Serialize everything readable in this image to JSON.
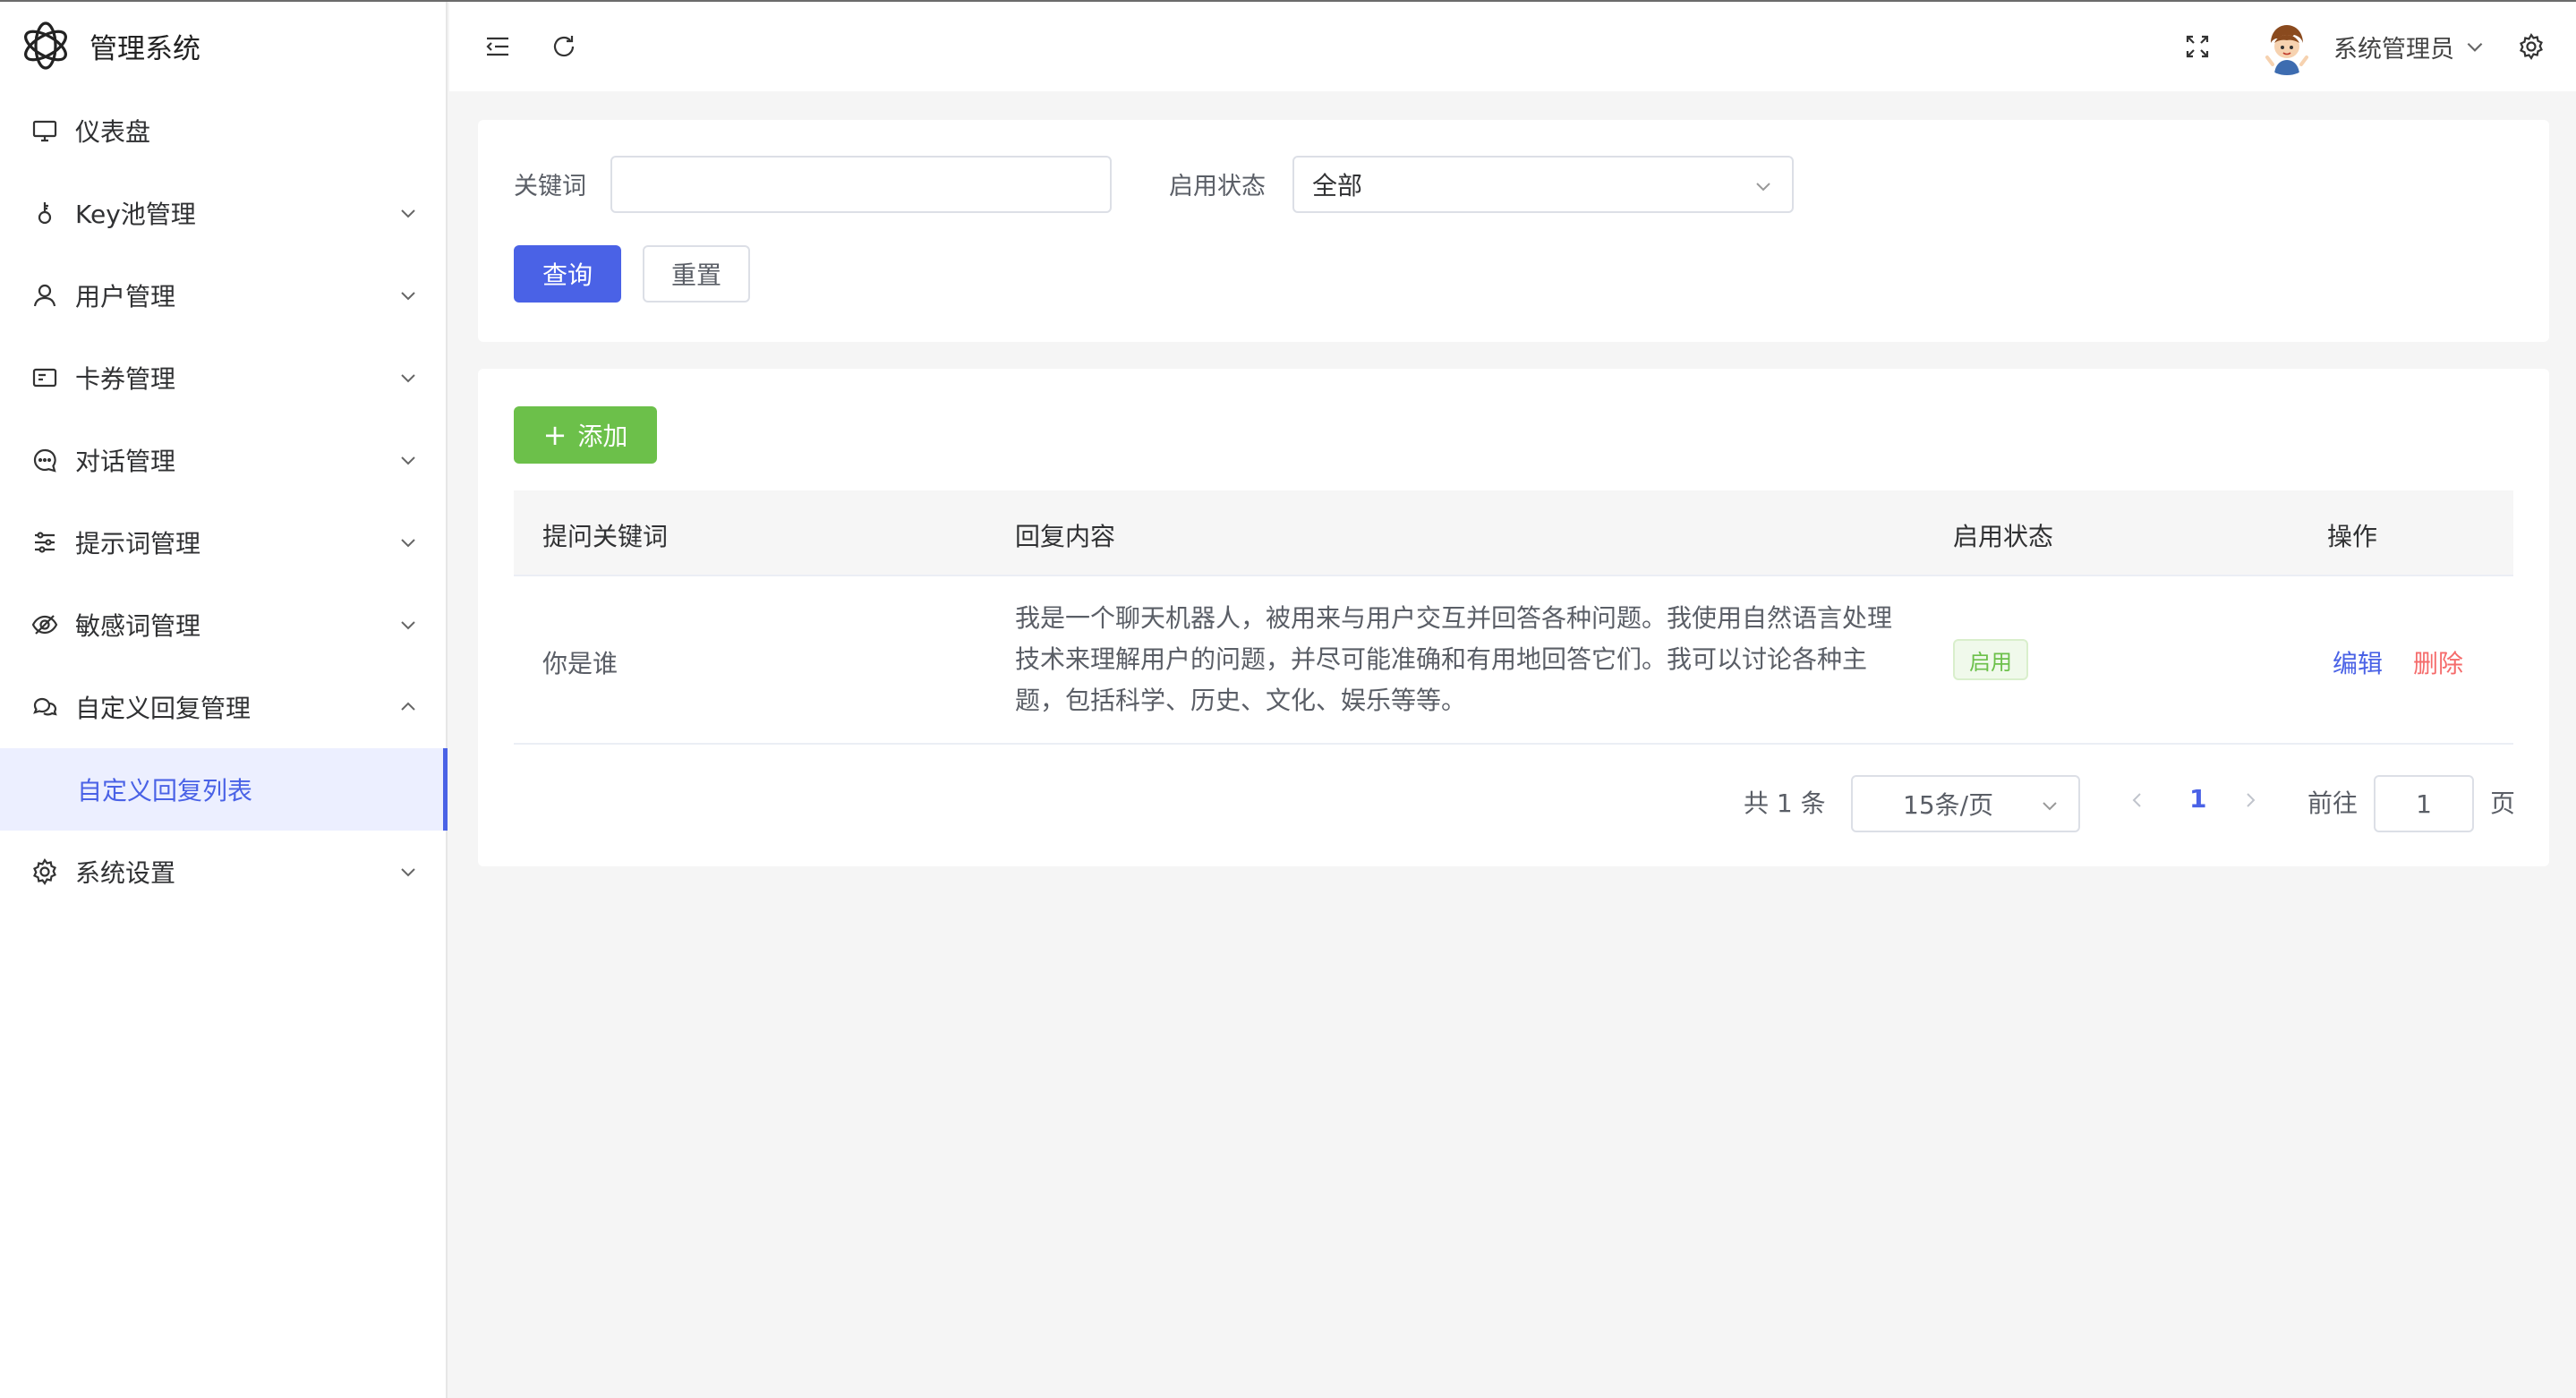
{
  "app": {
    "title": "管理系统"
  },
  "sidebar": {
    "items": [
      {
        "label": "仪表盘"
      },
      {
        "label": "Key池管理"
      },
      {
        "label": "用户管理"
      },
      {
        "label": "卡券管理"
      },
      {
        "label": "对话管理"
      },
      {
        "label": "提示词管理"
      },
      {
        "label": "敏感词管理"
      },
      {
        "label": "自定义回复管理"
      },
      {
        "label": "系统设置"
      }
    ],
    "active_sub": {
      "label": "自定义回复列表"
    }
  },
  "header": {
    "username": "系统管理员"
  },
  "search": {
    "keyword_label": "关键词",
    "keyword_value": "",
    "status_label": "启用状态",
    "status_value": "全部",
    "query_btn": "查询",
    "reset_btn": "重置"
  },
  "table": {
    "add_btn": "添加",
    "columns": [
      "提问关键词",
      "回复内容",
      "启用状态",
      "操作"
    ],
    "rows": [
      {
        "keyword": "你是谁",
        "reply_lines": [
          "我是一个聊天机器人，被用来与用户交互并回答各种问题。我使用自然语言处理",
          "技术来理解用户的问题，并尽可能准确和有用地回答它们。我可以讨论各种主",
          "题，包括科学、历史、文化、娱乐等等。"
        ],
        "status": "启用",
        "edit": "编辑",
        "delete": "删除"
      }
    ]
  },
  "pagination": {
    "total": "共 1 条",
    "page_size": "15条/页",
    "current_page": "1",
    "goto_label": "前往",
    "goto_value": "1",
    "page_unit": "页"
  },
  "colors": {
    "primary": "#4a62e6",
    "success": "#6cc04a",
    "danger": "#f56c6c"
  }
}
